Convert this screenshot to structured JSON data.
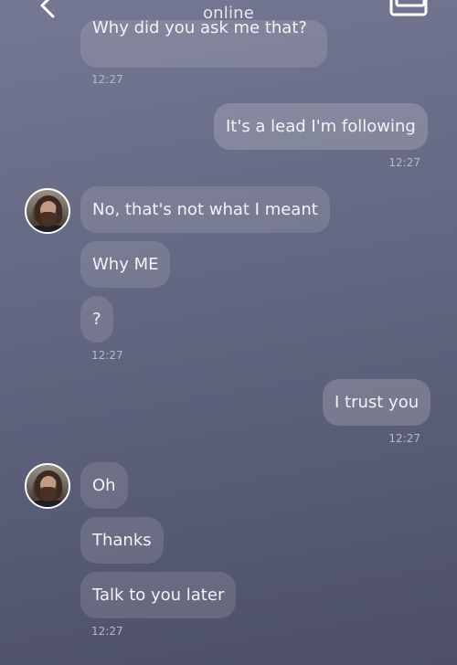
{
  "header": {
    "status": "online"
  },
  "messages": [
    {
      "text": "Why did you ask me that?",
      "time": "12:27",
      "direction": "incoming"
    },
    {
      "text": "It's a lead I'm following",
      "time": "12:27",
      "direction": "outgoing"
    },
    {
      "text": "No, that's not what I meant",
      "direction": "incoming"
    },
    {
      "text": "Why ME",
      "direction": "incoming"
    },
    {
      "text": "?",
      "time": "12:27",
      "direction": "incoming"
    },
    {
      "text": "I trust you",
      "time": "12:27",
      "direction": "outgoing"
    },
    {
      "text": "Oh",
      "direction": "incoming"
    },
    {
      "text": "Thanks",
      "direction": "incoming"
    },
    {
      "text": "Talk to you later",
      "time": "12:27",
      "direction": "incoming"
    }
  ],
  "icons": {
    "back": "chevron-left-icon",
    "gallery": "gallery-icon"
  },
  "colors": {
    "background_top": "#757892",
    "background_bottom": "#4c4f67",
    "bubble": "#ffffff1f"
  }
}
